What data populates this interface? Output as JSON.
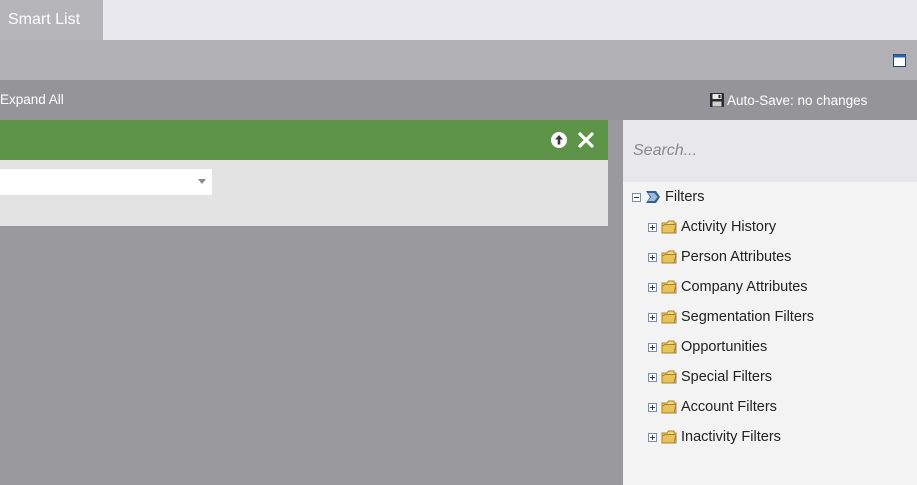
{
  "tabs": {
    "active_label": "Smart List"
  },
  "toolbar": {
    "expand_all_label": "Expand All",
    "autosave_label": "Auto-Save: no changes"
  },
  "search": {
    "placeholder": "Search..."
  },
  "tree": {
    "root_label": "Filters",
    "items": [
      {
        "label": "Activity History"
      },
      {
        "label": "Person Attributes"
      },
      {
        "label": "Company Attributes"
      },
      {
        "label": "Segmentation Filters"
      },
      {
        "label": "Opportunities"
      },
      {
        "label": "Special Filters"
      },
      {
        "label": "Account Filters"
      },
      {
        "label": "Inactivity Filters"
      }
    ]
  },
  "colors": {
    "filter_header": "#5e9448",
    "tab_strip": "#e9e8ee",
    "active_tab": "#b6b5ba",
    "toolbar": "#959499",
    "canvas": "#9a999e",
    "panel": "#f3f3f3",
    "folder": "#e8c25a"
  },
  "icons": {
    "window": "window-restore-icon",
    "autosave": "floppy-disk-icon",
    "move_up": "arrow-up-circle-icon",
    "close": "close-icon",
    "filters_root": "funnel-icon",
    "folder": "folder-icon"
  }
}
